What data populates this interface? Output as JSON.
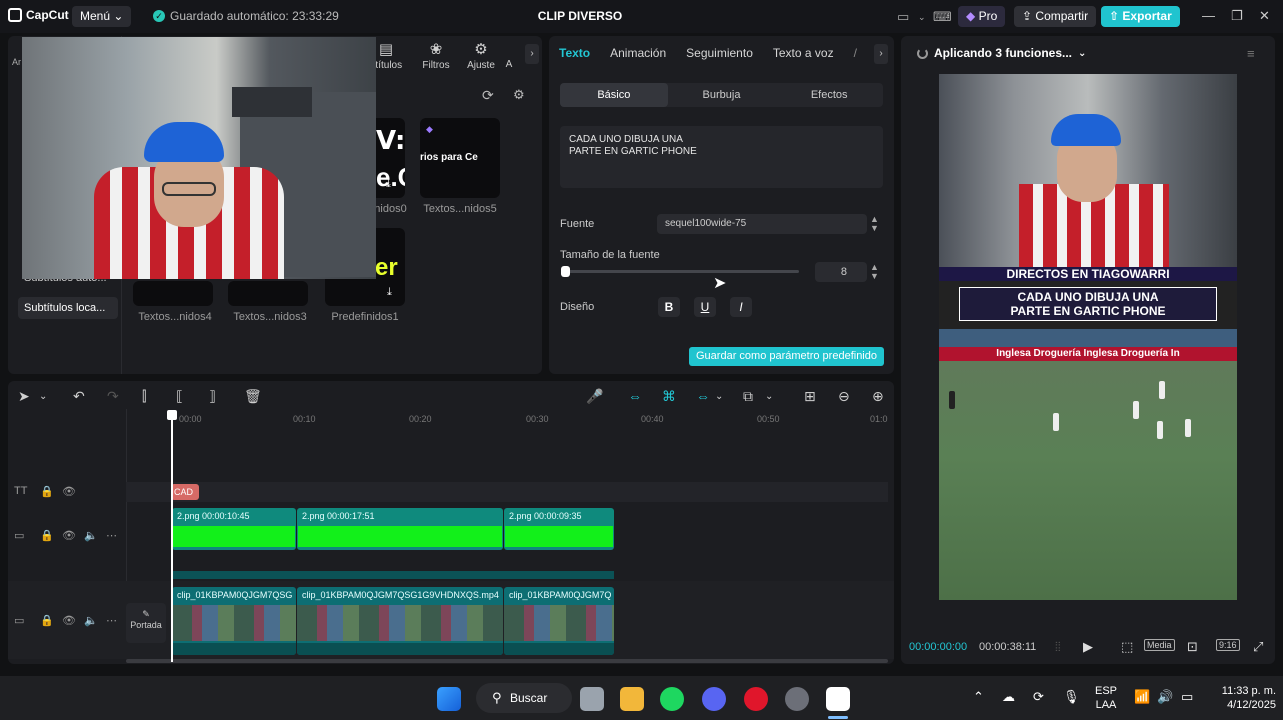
{
  "titlebar": {
    "app_name": "CapCut",
    "menu_label": "Menú",
    "autosave": "Guardado automático: 23:33:29",
    "project_title": "CLIP DIVERSO",
    "pro_label": "Pro",
    "share_label": "Compartir",
    "export_label": "Exportar"
  },
  "media": {
    "toolbar": [
      {
        "label": "otítulos"
      },
      {
        "label": "Filtros"
      },
      {
        "label": "Ajuste"
      },
      {
        "label": "A"
      }
    ],
    "sidebar": [
      {
        "label": "Subtítulos auto..."
      },
      {
        "label": "Subtítulos loca..."
      }
    ],
    "tiles": [
      {
        "label": "Textos...nidos0"
      },
      {
        "label": "Textos...nidos5"
      },
      {
        "label": "Textos...nidos4"
      },
      {
        "label": "Textos...nidos3"
      },
      {
        "label": "Predefinidos1"
      }
    ],
    "tile_texts": [
      "V:",
      "e.C",
      "rios para Ce",
      "er"
    ]
  },
  "properties": {
    "tabs": [
      "Texto",
      "Animación",
      "Seguimiento",
      "Texto a voz"
    ],
    "subtabs": [
      "Básico",
      "Burbuja",
      "Efectos"
    ],
    "text_content": "CADA UNO DIBUJA UNA\nPARTE EN GARTIC PHONE",
    "font_label": "Fuente",
    "font_value": "sequel100wide-75",
    "font_size_label": "Tamaño de la fuente",
    "font_size_value": "8",
    "font_size_fraction": 0.0,
    "design_label": "Diseño",
    "save_preset_label": "Guardar como parámetro predefinido"
  },
  "preview": {
    "status": "Aplicando 3 funciones...",
    "banner_text": "DIRECTOS EN  TIAGOWARRI",
    "caption_line1": "CADA UNO DIBUJA UNA",
    "caption_line2": "PARTE EN GARTIC PHONE",
    "ads_text": "Inglesa    Droguería Inglesa    Droguería In",
    "time_current": "00:00:00:00",
    "time_total": "00:00:38:11",
    "media_badge": "Media",
    "ratio_badge": "9:16"
  },
  "timeline": {
    "ruler": [
      "00:00",
      "00:10",
      "00:20",
      "00:30",
      "00:40",
      "00:50",
      "01:0"
    ],
    "text_clip_label": "CAD",
    "image_clips": [
      {
        "label": "2.png  00:00:10:45"
      },
      {
        "label": "2.png  00:00:17:51"
      },
      {
        "label": "2.png  00:00:09:35"
      }
    ],
    "video_clips": [
      {
        "label": "clip_01KBPAM0QJGM7QSG"
      },
      {
        "label": "clip_01KBPAM0QJGM7QSG1G9VHDNXQS.mp4"
      },
      {
        "label": "clip_01KBPAM0QJGM7Q"
      }
    ],
    "cover_label": "Portada"
  },
  "taskbar": {
    "search_label": "Buscar",
    "lang_line1": "ESP",
    "lang_line2": "LAA",
    "time": "11:33 p. m.",
    "date": "4/12/2025"
  }
}
